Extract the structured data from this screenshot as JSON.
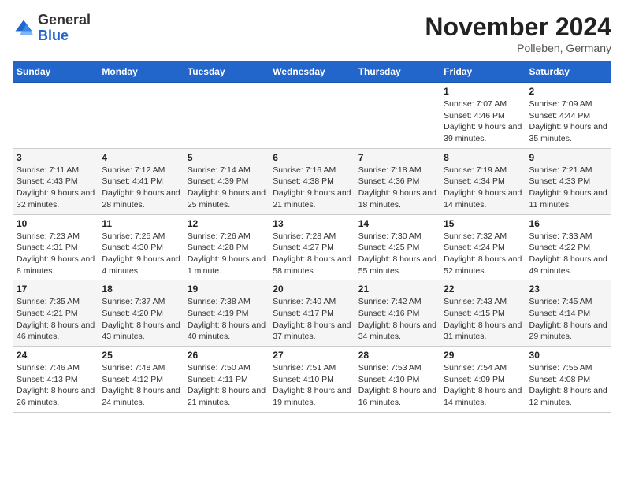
{
  "header": {
    "logo_general": "General",
    "logo_blue": "Blue",
    "month_title": "November 2024",
    "location": "Polleben, Germany"
  },
  "days_of_week": [
    "Sunday",
    "Monday",
    "Tuesday",
    "Wednesday",
    "Thursday",
    "Friday",
    "Saturday"
  ],
  "weeks": [
    [
      {
        "day": "",
        "info": ""
      },
      {
        "day": "",
        "info": ""
      },
      {
        "day": "",
        "info": ""
      },
      {
        "day": "",
        "info": ""
      },
      {
        "day": "",
        "info": ""
      },
      {
        "day": "1",
        "info": "Sunrise: 7:07 AM\nSunset: 4:46 PM\nDaylight: 9 hours and 39 minutes."
      },
      {
        "day": "2",
        "info": "Sunrise: 7:09 AM\nSunset: 4:44 PM\nDaylight: 9 hours and 35 minutes."
      }
    ],
    [
      {
        "day": "3",
        "info": "Sunrise: 7:11 AM\nSunset: 4:43 PM\nDaylight: 9 hours and 32 minutes."
      },
      {
        "day": "4",
        "info": "Sunrise: 7:12 AM\nSunset: 4:41 PM\nDaylight: 9 hours and 28 minutes."
      },
      {
        "day": "5",
        "info": "Sunrise: 7:14 AM\nSunset: 4:39 PM\nDaylight: 9 hours and 25 minutes."
      },
      {
        "day": "6",
        "info": "Sunrise: 7:16 AM\nSunset: 4:38 PM\nDaylight: 9 hours and 21 minutes."
      },
      {
        "day": "7",
        "info": "Sunrise: 7:18 AM\nSunset: 4:36 PM\nDaylight: 9 hours and 18 minutes."
      },
      {
        "day": "8",
        "info": "Sunrise: 7:19 AM\nSunset: 4:34 PM\nDaylight: 9 hours and 14 minutes."
      },
      {
        "day": "9",
        "info": "Sunrise: 7:21 AM\nSunset: 4:33 PM\nDaylight: 9 hours and 11 minutes."
      }
    ],
    [
      {
        "day": "10",
        "info": "Sunrise: 7:23 AM\nSunset: 4:31 PM\nDaylight: 9 hours and 8 minutes."
      },
      {
        "day": "11",
        "info": "Sunrise: 7:25 AM\nSunset: 4:30 PM\nDaylight: 9 hours and 4 minutes."
      },
      {
        "day": "12",
        "info": "Sunrise: 7:26 AM\nSunset: 4:28 PM\nDaylight: 9 hours and 1 minute."
      },
      {
        "day": "13",
        "info": "Sunrise: 7:28 AM\nSunset: 4:27 PM\nDaylight: 8 hours and 58 minutes."
      },
      {
        "day": "14",
        "info": "Sunrise: 7:30 AM\nSunset: 4:25 PM\nDaylight: 8 hours and 55 minutes."
      },
      {
        "day": "15",
        "info": "Sunrise: 7:32 AM\nSunset: 4:24 PM\nDaylight: 8 hours and 52 minutes."
      },
      {
        "day": "16",
        "info": "Sunrise: 7:33 AM\nSunset: 4:22 PM\nDaylight: 8 hours and 49 minutes."
      }
    ],
    [
      {
        "day": "17",
        "info": "Sunrise: 7:35 AM\nSunset: 4:21 PM\nDaylight: 8 hours and 46 minutes."
      },
      {
        "day": "18",
        "info": "Sunrise: 7:37 AM\nSunset: 4:20 PM\nDaylight: 8 hours and 43 minutes."
      },
      {
        "day": "19",
        "info": "Sunrise: 7:38 AM\nSunset: 4:19 PM\nDaylight: 8 hours and 40 minutes."
      },
      {
        "day": "20",
        "info": "Sunrise: 7:40 AM\nSunset: 4:17 PM\nDaylight: 8 hours and 37 minutes."
      },
      {
        "day": "21",
        "info": "Sunrise: 7:42 AM\nSunset: 4:16 PM\nDaylight: 8 hours and 34 minutes."
      },
      {
        "day": "22",
        "info": "Sunrise: 7:43 AM\nSunset: 4:15 PM\nDaylight: 8 hours and 31 minutes."
      },
      {
        "day": "23",
        "info": "Sunrise: 7:45 AM\nSunset: 4:14 PM\nDaylight: 8 hours and 29 minutes."
      }
    ],
    [
      {
        "day": "24",
        "info": "Sunrise: 7:46 AM\nSunset: 4:13 PM\nDaylight: 8 hours and 26 minutes."
      },
      {
        "day": "25",
        "info": "Sunrise: 7:48 AM\nSunset: 4:12 PM\nDaylight: 8 hours and 24 minutes."
      },
      {
        "day": "26",
        "info": "Sunrise: 7:50 AM\nSunset: 4:11 PM\nDaylight: 8 hours and 21 minutes."
      },
      {
        "day": "27",
        "info": "Sunrise: 7:51 AM\nSunset: 4:10 PM\nDaylight: 8 hours and 19 minutes."
      },
      {
        "day": "28",
        "info": "Sunrise: 7:53 AM\nSunset: 4:10 PM\nDaylight: 8 hours and 16 minutes."
      },
      {
        "day": "29",
        "info": "Sunrise: 7:54 AM\nSunset: 4:09 PM\nDaylight: 8 hours and 14 minutes."
      },
      {
        "day": "30",
        "info": "Sunrise: 7:55 AM\nSunset: 4:08 PM\nDaylight: 8 hours and 12 minutes."
      }
    ]
  ]
}
